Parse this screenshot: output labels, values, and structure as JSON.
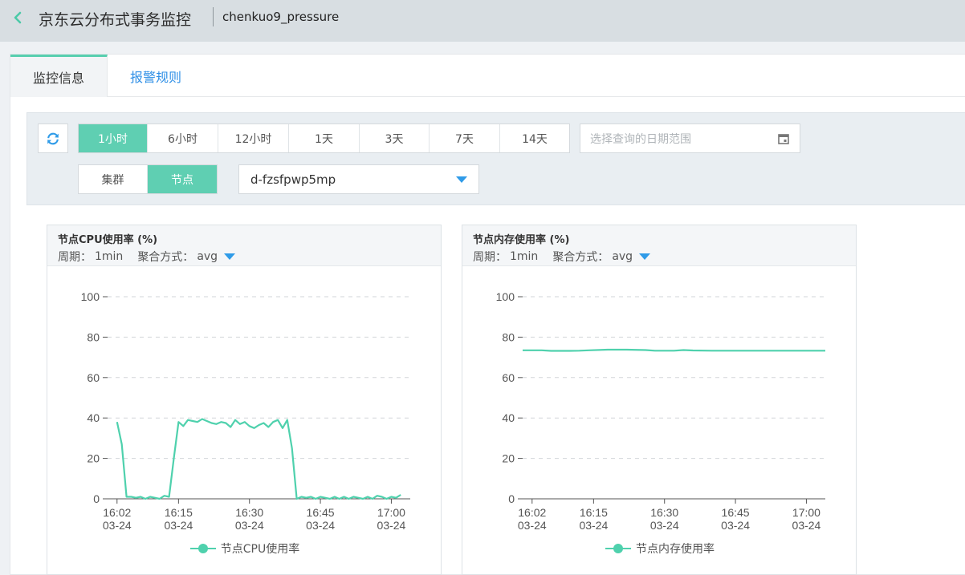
{
  "header": {
    "title": "京东云分布式事务监控",
    "instance": "chenkuo9_pressure"
  },
  "tabs": [
    {
      "label": "监控信息",
      "active": true
    },
    {
      "label": "报警规则",
      "active": false
    }
  ],
  "filters": {
    "time_ranges": [
      "1小时",
      "6小时",
      "12小时",
      "1天",
      "3天",
      "7天",
      "14天"
    ],
    "selected_time": "1小时",
    "date_placeholder": "选择查询的日期范围",
    "scopes": [
      "集群",
      "节点"
    ],
    "selected_scope": "节点",
    "node": "d-fzsfpwp5mp"
  },
  "charts": [
    {
      "title": "节点CPU使用率 (%)",
      "period_label": "周期：",
      "period": "1min",
      "agg_label": "聚合方式：",
      "agg": "avg",
      "legend": "节点CPU使用率"
    },
    {
      "title": "节点内存使用率 (%)",
      "period_label": "周期：",
      "period": "1min",
      "agg_label": "聚合方式：",
      "agg": "avg",
      "legend": "节点内存使用率"
    }
  ],
  "chart_data": [
    {
      "type": "line",
      "title": "节点CPU使用率 (%)",
      "ylim": [
        0,
        100
      ],
      "y_ticks": [
        0,
        20,
        40,
        60,
        80,
        100
      ],
      "x_ticks": [
        "16:02 03-24",
        "16:15 03-24",
        "16:30 03-24",
        "16:45 03-24",
        "17:00 03-24"
      ],
      "x_tick_minutes": [
        2,
        15,
        30,
        45,
        60
      ],
      "grid": true,
      "series": [
        {
          "name": "节点CPU使用率",
          "color": "#4fd1ad",
          "x": [
            2,
            3,
            4,
            5,
            6,
            7,
            8,
            9,
            10,
            11,
            12,
            13,
            14,
            15,
            16,
            17,
            18,
            19,
            20,
            21,
            22,
            23,
            24,
            25,
            26,
            27,
            28,
            29,
            30,
            31,
            32,
            33,
            34,
            35,
            36,
            37,
            38,
            39,
            40,
            41,
            42,
            43,
            44,
            45,
            46,
            47,
            48,
            49,
            50,
            51,
            52,
            53,
            54,
            55,
            56,
            57,
            58,
            59,
            60,
            61,
            62
          ],
          "values": [
            38,
            27,
            1,
            1,
            0.5,
            1,
            0,
            1,
            0.5,
            0,
            1.5,
            1,
            20,
            38,
            36,
            39,
            38.5,
            38,
            39.5,
            38.5,
            37.5,
            37,
            38,
            37.5,
            35.5,
            39,
            37,
            38,
            36,
            35,
            36.5,
            37.5,
            35.5,
            38,
            39,
            35,
            39,
            25,
            0,
            1,
            0.5,
            1,
            0,
            1,
            0.5,
            0,
            1,
            0,
            1,
            0,
            1,
            0.5,
            0,
            1,
            0,
            1.5,
            1,
            0,
            1,
            0.5,
            2
          ]
        }
      ]
    },
    {
      "type": "line",
      "title": "节点内存使用率 (%)",
      "ylim": [
        0,
        100
      ],
      "y_ticks": [
        0,
        20,
        40,
        60,
        80,
        100
      ],
      "x_ticks": [
        "16:02 03-24",
        "16:15 03-24",
        "16:30 03-24",
        "16:45 03-24",
        "17:00 03-24"
      ],
      "x_tick_minutes": [
        2,
        15,
        30,
        45,
        60
      ],
      "grid": true,
      "series": [
        {
          "name": "节点内存使用率",
          "color": "#4fd1ad",
          "x": [
            0,
            4,
            6,
            10,
            12,
            14,
            18,
            22,
            26,
            28,
            32,
            34,
            36,
            40,
            46,
            52,
            58,
            64
          ],
          "values": [
            73.5,
            73.5,
            73.2,
            73.2,
            73.3,
            73.5,
            73.8,
            73.8,
            73.6,
            73.3,
            73.3,
            73.6,
            73.4,
            73.3,
            73.3,
            73.3,
            73.3,
            73.3
          ]
        }
      ]
    }
  ]
}
